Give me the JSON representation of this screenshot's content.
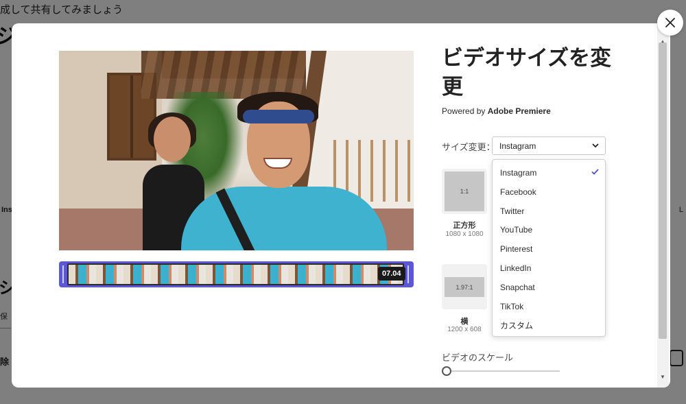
{
  "background": {
    "top_text": "成して共有してみましょう",
    "heading": "ジ",
    "left_fragment": "Ins",
    "section_char": "シ",
    "small_char": "保",
    "delete_char": "除",
    "right_fragment": "L"
  },
  "modal": {
    "title": "ビデオサイズを変更",
    "powered_prefix": "Powered by ",
    "powered_brand": "Adobe Premiere",
    "timeline": {
      "time": "07.04"
    },
    "resize": {
      "label": "サイズ変更：",
      "selected": "Instagram",
      "options": [
        "Instagram",
        "Facebook",
        "Twitter",
        "YouTube",
        "Pinterest",
        "LinkedIn",
        "Snapchat",
        "TikTok",
        "カスタム"
      ]
    },
    "aspects": [
      {
        "ratio": "1:1",
        "name": "正方形",
        "size": "1080 x 1080"
      },
      {
        "ratio": "1.97:1",
        "name": "横",
        "size": "1200 x 608"
      }
    ],
    "scale": {
      "label": "ビデオのスケール",
      "value": 0
    }
  },
  "colors": {
    "accent": "#5b57d8",
    "check": "#4b4fc8"
  },
  "icons": {
    "close": "close-icon",
    "chevron": "chevron-down-icon",
    "check": "checkmark-icon"
  }
}
